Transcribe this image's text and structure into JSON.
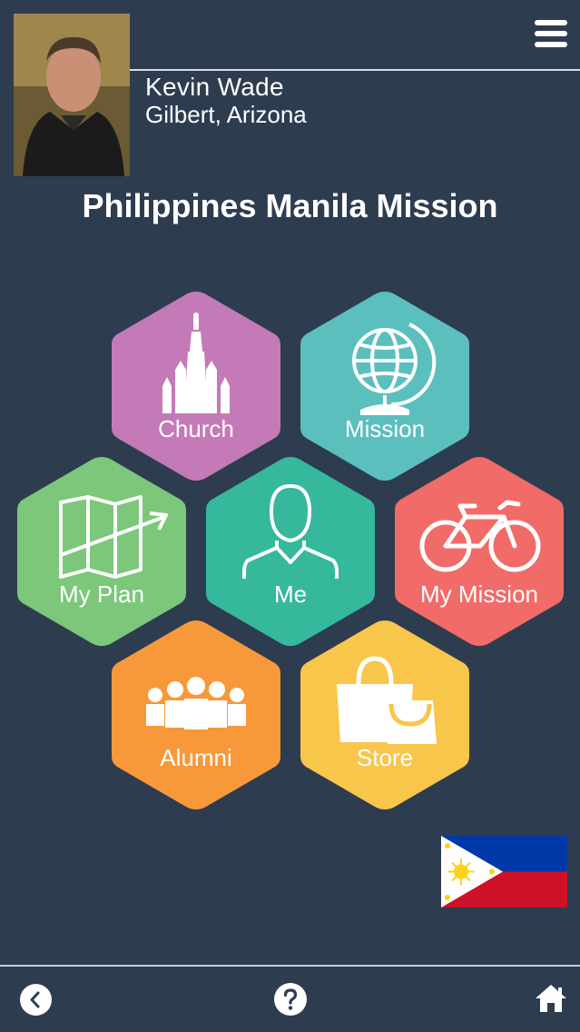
{
  "profile": {
    "name": "Kevin Wade",
    "location": "Gilbert, Arizona"
  },
  "page": {
    "title": "Philippines Manila Mission"
  },
  "tiles": {
    "church": {
      "label": "Church",
      "color": "#c47ab7",
      "icon": "temple-icon"
    },
    "mission": {
      "label": "Mission",
      "color": "#5bbfbd",
      "icon": "globe-icon"
    },
    "my_plan": {
      "label": "My Plan",
      "color": "#7cc77a",
      "icon": "map-icon"
    },
    "me": {
      "label": "Me",
      "color": "#35b89b",
      "icon": "person-icon"
    },
    "my_mission": {
      "label": "My Mission",
      "color": "#f16b69",
      "icon": "bicycle-icon"
    },
    "alumni": {
      "label": "Alumni",
      "color": "#f7983b",
      "icon": "people-icon"
    },
    "store": {
      "label": "Store",
      "color": "#f8c64a",
      "icon": "shopping-bag-icon"
    }
  },
  "colors": {
    "background": "#2e3c50",
    "flag_blue": "#0038a8",
    "flag_red": "#ce1126",
    "flag_sun": "#fcd116"
  },
  "footer": {
    "back_icon": "back-arrow-icon",
    "help_icon": "question-icon",
    "home_icon": "home-icon"
  }
}
